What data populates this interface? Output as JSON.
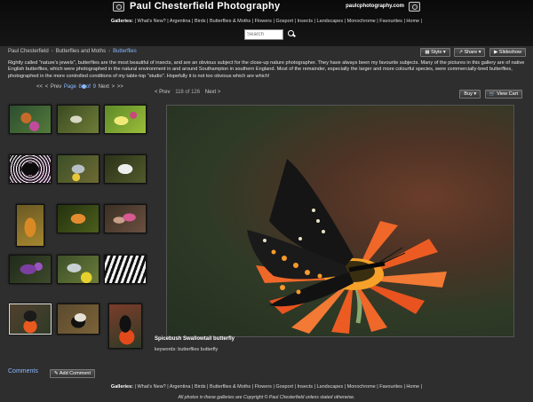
{
  "header": {
    "title": "Paul Chesterfield Photography",
    "url": "paulcphotography.com",
    "galleries_label": "Galleries:",
    "nav": [
      "What's New?",
      "Argentina",
      "Birds",
      "Butterflies & Moths",
      "Flowers",
      "Gosport",
      "Insects",
      "Landscapes",
      "Monochrome",
      "Favourites",
      "Home"
    ]
  },
  "search": {
    "placeholder": "Search"
  },
  "breadcrumb": [
    "Paul Chesterfield",
    "Butterflies and Moths",
    "Butterflies"
  ],
  "toolbar": {
    "style_label": "Style",
    "share_label": "Share",
    "slideshow_label": "Slideshow"
  },
  "gallery": {
    "description": "Rightly called \"nature's jewels\", butterflies are the most beautiful of insects, and are an obvious subject for the close-up nature photographer. They have always been my favourite subjects. Many of the pictures in this gallery are of native English butterflies, which were photographed in the natural environment in and around Southampton in southern England. Most of the remainder, especially the larger and more colourful species, were commercially-bred butterflies, photographed in the more controlled conditions of my table-top \"studio\". Hopefully it is not too obvious which are which!"
  },
  "pager": {
    "first": "<<",
    "prev": "< Prev",
    "page": "Page 8",
    "of": "of 9",
    "next": "Next >",
    "last": ">>"
  },
  "photo_nav": {
    "prev": "< Prev",
    "count": "118 of 126",
    "next": "Next >"
  },
  "photo_buttons": {
    "buy_label": "Buy",
    "cart_label": "View Cart"
  },
  "photo": {
    "caption": "Spicebush Swallowtail butterfly",
    "keywords_label": "keywords:",
    "keywords": "butterflies butterfly"
  },
  "comments": {
    "label": "Comments",
    "add_label": "Add Comment"
  },
  "footer": {
    "galleries_label": "Galleries:",
    "nav": [
      "What's New?",
      "Argentina",
      "Birds",
      "Butterflies & Moths",
      "Flowers",
      "Gosport",
      "Insects",
      "Landscapes",
      "Monochrome",
      "Favourites",
      "Home"
    ],
    "copyright": "All photos in these galleries are Copyright © Paul Chesterfield unless stated otherwise."
  },
  "colors": {
    "link": "#8bbaff",
    "background": "#2e2e2e",
    "header": "#0a0a0a"
  }
}
